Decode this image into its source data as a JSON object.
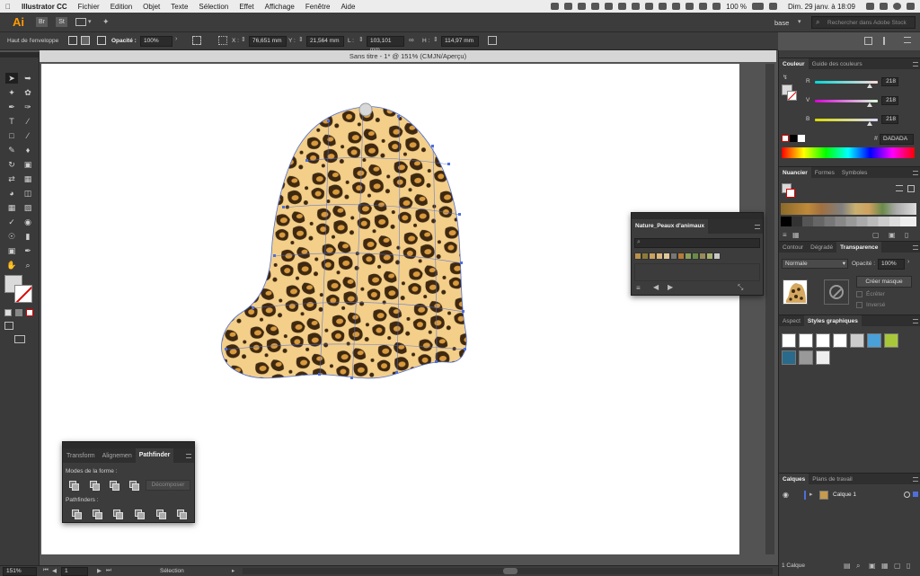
{
  "menubar": {
    "apple_icon": "apple-icon",
    "items": [
      "Illustrator CC",
      "Fichier",
      "Edition",
      "Objet",
      "Texte",
      "Sélection",
      "Effet",
      "Affichage",
      "Fenêtre",
      "Aide"
    ],
    "battery": "100 %",
    "datetime": "Dim. 29 janv. à 18:09"
  },
  "appbar": {
    "logo": "Ai",
    "br": "Br",
    "st": "St",
    "workspace": "base",
    "search_placeholder": "Rechercher dans Adobe Stock"
  },
  "control": {
    "envelope_label": "Haut de l'enveloppe",
    "opacity_label": "Opacité :",
    "opacity_value": "100%",
    "x_label": "X :",
    "x_value": "76,651 mm",
    "y_label": "Y :",
    "y_value": "21,564 mm",
    "w_label": "L :",
    "w_value": "103,101 mm",
    "h_label": "H :",
    "h_value": "114,97 mm"
  },
  "document": {
    "title": "Sans titre - 1* @ 151% (CMJN/Aperçu)"
  },
  "status": {
    "zoom": "151%",
    "page": "1",
    "tool": "Sélection"
  },
  "pathfinder": {
    "tabs": [
      "Transform",
      "Alignemen",
      "Pathfinder"
    ],
    "shape_modes_label": "Modes de la forme :",
    "expand_label": "Décomposer",
    "pathfinders_label": "Pathfinders :"
  },
  "nature_panel": {
    "tab": "Nature_Peaux d'animaux"
  },
  "color_panel": {
    "tabs": [
      "Couleur",
      "Guide des couleurs"
    ],
    "r_label": "R",
    "g_label": "V",
    "b_label": "B",
    "r": 218,
    "g": 218,
    "b": 218,
    "hex": "DADADA"
  },
  "swatches_panel": {
    "tabs": [
      "Nuancier",
      "Formes",
      "Symboles"
    ]
  },
  "transparency_panel": {
    "tabs": [
      "Contour",
      "Dégradé",
      "Transparence"
    ],
    "mode": "Normale",
    "opacity_label": "Opacité :",
    "opacity_value": "100%",
    "mask_button": "Créer masque",
    "clip_label": "Écrêter",
    "invert_label": "Inversé"
  },
  "styles_panel": {
    "tabs": [
      "Aspect",
      "Styles graphiques"
    ]
  },
  "layers_panel": {
    "tabs": [
      "Calques",
      "Plans de travail"
    ],
    "layer_name": "Calque 1",
    "footer": "1 Calque"
  },
  "colors": {
    "leopard_base": "#f3cf8a",
    "leopard_spot": "#3e2810",
    "leopard_inner": "#d99a3c",
    "selection_blue": "#4f6fd8"
  }
}
